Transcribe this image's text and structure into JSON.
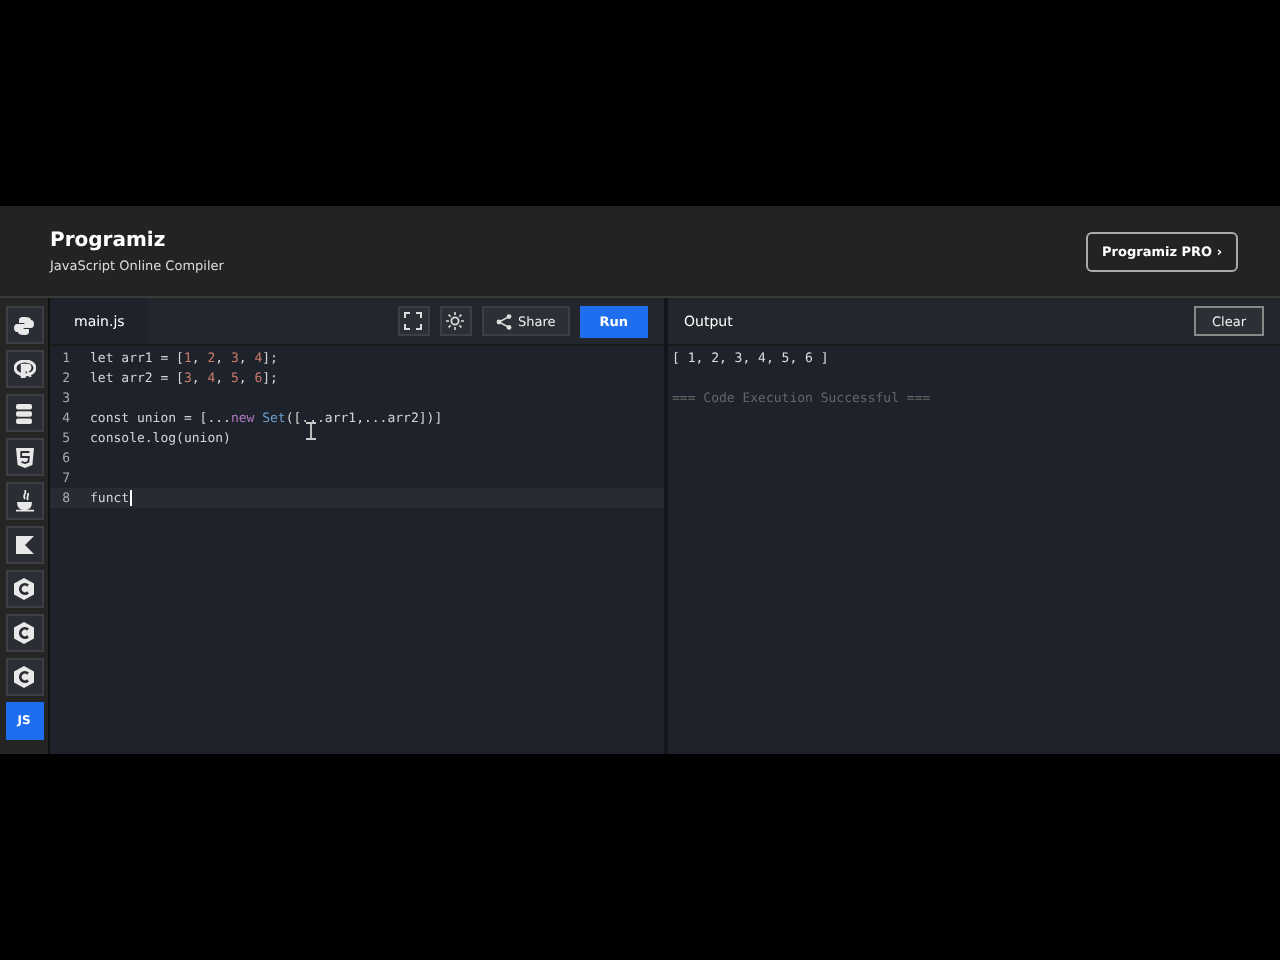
{
  "header": {
    "logo": "Programiz",
    "subtitle": "JavaScript Online Compiler",
    "pro_button": "Programiz PRO ›"
  },
  "sidebar": {
    "items": [
      {
        "kind": "python",
        "selected": false
      },
      {
        "kind": "r",
        "selected": false
      },
      {
        "kind": "sql",
        "selected": false
      },
      {
        "kind": "html",
        "selected": false
      },
      {
        "kind": "java",
        "selected": false
      },
      {
        "kind": "kotlin",
        "selected": false
      },
      {
        "kind": "c",
        "selected": false
      },
      {
        "kind": "c",
        "selected": false
      },
      {
        "kind": "c",
        "selected": false
      },
      {
        "kind": "text",
        "label": "JS",
        "selected": true
      }
    ]
  },
  "editor": {
    "tab": "main.js",
    "share_button": "Share",
    "run_button": "Run",
    "lines": [
      {
        "number": "1",
        "active": false,
        "tokens": [
          {
            "text": "let arr1 = [",
            "kind": "plain"
          },
          {
            "text": "1",
            "kind": "number"
          },
          {
            "text": ", ",
            "kind": "plain"
          },
          {
            "text": "2",
            "kind": "number"
          },
          {
            "text": ", ",
            "kind": "plain"
          },
          {
            "text": "3",
            "kind": "number"
          },
          {
            "text": ", ",
            "kind": "plain"
          },
          {
            "text": "4",
            "kind": "number"
          },
          {
            "text": "];",
            "kind": "plain"
          }
        ]
      },
      {
        "number": "2",
        "active": false,
        "tokens": [
          {
            "text": "let arr2 = [",
            "kind": "plain"
          },
          {
            "text": "3",
            "kind": "number"
          },
          {
            "text": ", ",
            "kind": "plain"
          },
          {
            "text": "4",
            "kind": "number"
          },
          {
            "text": ", ",
            "kind": "plain"
          },
          {
            "text": "5",
            "kind": "number"
          },
          {
            "text": ", ",
            "kind": "plain"
          },
          {
            "text": "6",
            "kind": "number"
          },
          {
            "text": "];",
            "kind": "plain"
          }
        ]
      },
      {
        "number": "3",
        "active": false
      },
      {
        "number": "4",
        "active": false,
        "tokens": [
          {
            "text": "const union = [...",
            "kind": "plain"
          },
          {
            "text": "new",
            "kind": "keyword"
          },
          {
            "text": "Set",
            "kind": "builtin"
          },
          {
            "text": "([...arr1,...arr2])]",
            "kind": "plain"
          }
        ]
      },
      {
        "number": "5",
        "active": false,
        "tokens": [
          {
            "text": "console.log(union)",
            "kind": "plain"
          }
        ]
      },
      {
        "number": "6",
        "active": false
      },
      {
        "number": "7",
        "active": false
      },
      {
        "number": "8",
        "active": true,
        "tokens": [
          {
            "text": "funct",
            "kind": "plain"
          }
        ]
      }
    ]
  },
  "output": {
    "title": "Output",
    "clear_button": "Clear",
    "lines": [
      {
        "text": "[ 1, 2, 3, 4, 5, 6 ]",
        "kind": "result"
      },
      {
        "text": "=== Code Execution Successful ===",
        "kind": "status"
      }
    ]
  }
}
